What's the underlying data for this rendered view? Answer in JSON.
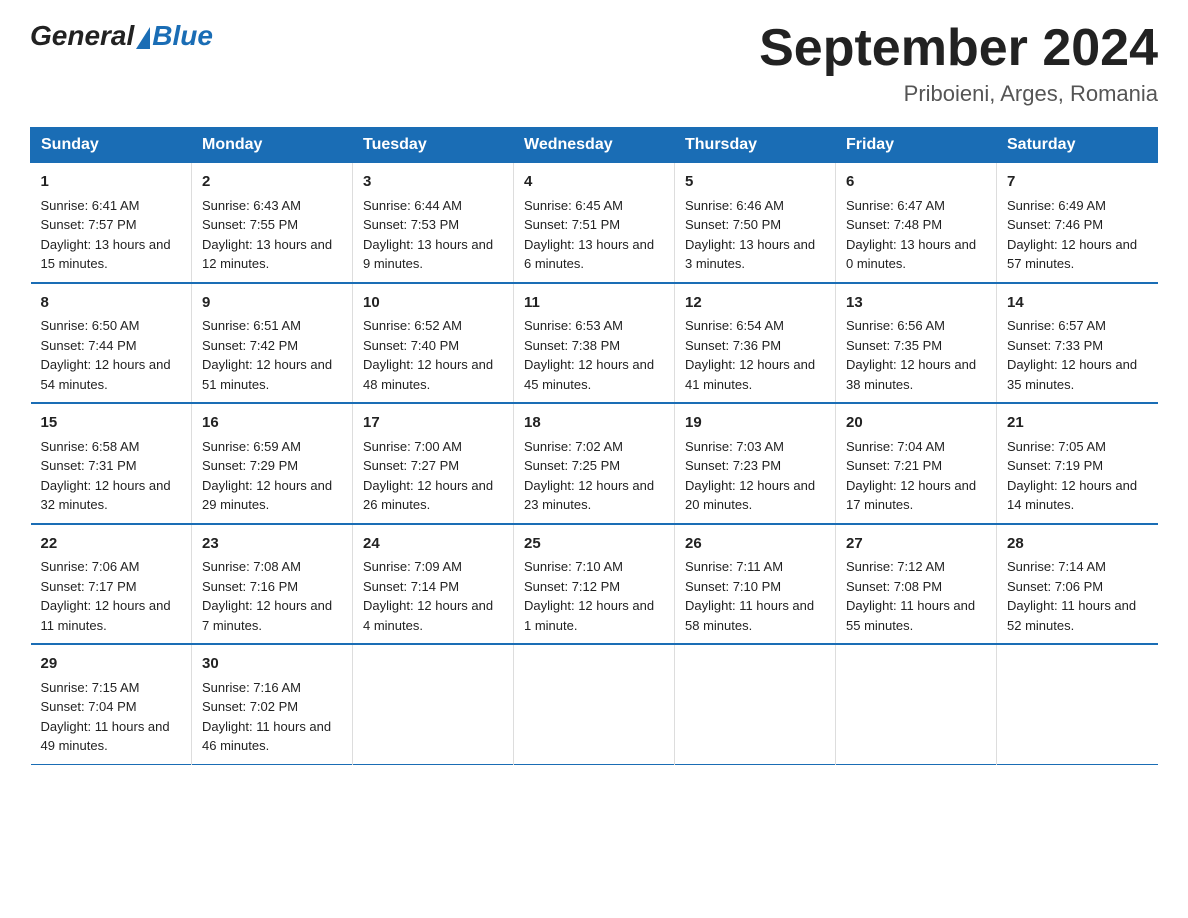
{
  "logo": {
    "general": "General",
    "blue": "Blue"
  },
  "title": {
    "month_year": "September 2024",
    "location": "Priboieni, Arges, Romania"
  },
  "headers": [
    "Sunday",
    "Monday",
    "Tuesday",
    "Wednesday",
    "Thursday",
    "Friday",
    "Saturday"
  ],
  "weeks": [
    [
      {
        "day": "1",
        "sunrise": "6:41 AM",
        "sunset": "7:57 PM",
        "daylight": "13 hours and 15 minutes."
      },
      {
        "day": "2",
        "sunrise": "6:43 AM",
        "sunset": "7:55 PM",
        "daylight": "13 hours and 12 minutes."
      },
      {
        "day": "3",
        "sunrise": "6:44 AM",
        "sunset": "7:53 PM",
        "daylight": "13 hours and 9 minutes."
      },
      {
        "day": "4",
        "sunrise": "6:45 AM",
        "sunset": "7:51 PM",
        "daylight": "13 hours and 6 minutes."
      },
      {
        "day": "5",
        "sunrise": "6:46 AM",
        "sunset": "7:50 PM",
        "daylight": "13 hours and 3 minutes."
      },
      {
        "day": "6",
        "sunrise": "6:47 AM",
        "sunset": "7:48 PM",
        "daylight": "13 hours and 0 minutes."
      },
      {
        "day": "7",
        "sunrise": "6:49 AM",
        "sunset": "7:46 PM",
        "daylight": "12 hours and 57 minutes."
      }
    ],
    [
      {
        "day": "8",
        "sunrise": "6:50 AM",
        "sunset": "7:44 PM",
        "daylight": "12 hours and 54 minutes."
      },
      {
        "day": "9",
        "sunrise": "6:51 AM",
        "sunset": "7:42 PM",
        "daylight": "12 hours and 51 minutes."
      },
      {
        "day": "10",
        "sunrise": "6:52 AM",
        "sunset": "7:40 PM",
        "daylight": "12 hours and 48 minutes."
      },
      {
        "day": "11",
        "sunrise": "6:53 AM",
        "sunset": "7:38 PM",
        "daylight": "12 hours and 45 minutes."
      },
      {
        "day": "12",
        "sunrise": "6:54 AM",
        "sunset": "7:36 PM",
        "daylight": "12 hours and 41 minutes."
      },
      {
        "day": "13",
        "sunrise": "6:56 AM",
        "sunset": "7:35 PM",
        "daylight": "12 hours and 38 minutes."
      },
      {
        "day": "14",
        "sunrise": "6:57 AM",
        "sunset": "7:33 PM",
        "daylight": "12 hours and 35 minutes."
      }
    ],
    [
      {
        "day": "15",
        "sunrise": "6:58 AM",
        "sunset": "7:31 PM",
        "daylight": "12 hours and 32 minutes."
      },
      {
        "day": "16",
        "sunrise": "6:59 AM",
        "sunset": "7:29 PM",
        "daylight": "12 hours and 29 minutes."
      },
      {
        "day": "17",
        "sunrise": "7:00 AM",
        "sunset": "7:27 PM",
        "daylight": "12 hours and 26 minutes."
      },
      {
        "day": "18",
        "sunrise": "7:02 AM",
        "sunset": "7:25 PM",
        "daylight": "12 hours and 23 minutes."
      },
      {
        "day": "19",
        "sunrise": "7:03 AM",
        "sunset": "7:23 PM",
        "daylight": "12 hours and 20 minutes."
      },
      {
        "day": "20",
        "sunrise": "7:04 AM",
        "sunset": "7:21 PM",
        "daylight": "12 hours and 17 minutes."
      },
      {
        "day": "21",
        "sunrise": "7:05 AM",
        "sunset": "7:19 PM",
        "daylight": "12 hours and 14 minutes."
      }
    ],
    [
      {
        "day": "22",
        "sunrise": "7:06 AM",
        "sunset": "7:17 PM",
        "daylight": "12 hours and 11 minutes."
      },
      {
        "day": "23",
        "sunrise": "7:08 AM",
        "sunset": "7:16 PM",
        "daylight": "12 hours and 7 minutes."
      },
      {
        "day": "24",
        "sunrise": "7:09 AM",
        "sunset": "7:14 PM",
        "daylight": "12 hours and 4 minutes."
      },
      {
        "day": "25",
        "sunrise": "7:10 AM",
        "sunset": "7:12 PM",
        "daylight": "12 hours and 1 minute."
      },
      {
        "day": "26",
        "sunrise": "7:11 AM",
        "sunset": "7:10 PM",
        "daylight": "11 hours and 58 minutes."
      },
      {
        "day": "27",
        "sunrise": "7:12 AM",
        "sunset": "7:08 PM",
        "daylight": "11 hours and 55 minutes."
      },
      {
        "day": "28",
        "sunrise": "7:14 AM",
        "sunset": "7:06 PM",
        "daylight": "11 hours and 52 minutes."
      }
    ],
    [
      {
        "day": "29",
        "sunrise": "7:15 AM",
        "sunset": "7:04 PM",
        "daylight": "11 hours and 49 minutes."
      },
      {
        "day": "30",
        "sunrise": "7:16 AM",
        "sunset": "7:02 PM",
        "daylight": "11 hours and 46 minutes."
      },
      null,
      null,
      null,
      null,
      null
    ]
  ],
  "labels": {
    "sunrise": "Sunrise:",
    "sunset": "Sunset:",
    "daylight": "Daylight:"
  }
}
